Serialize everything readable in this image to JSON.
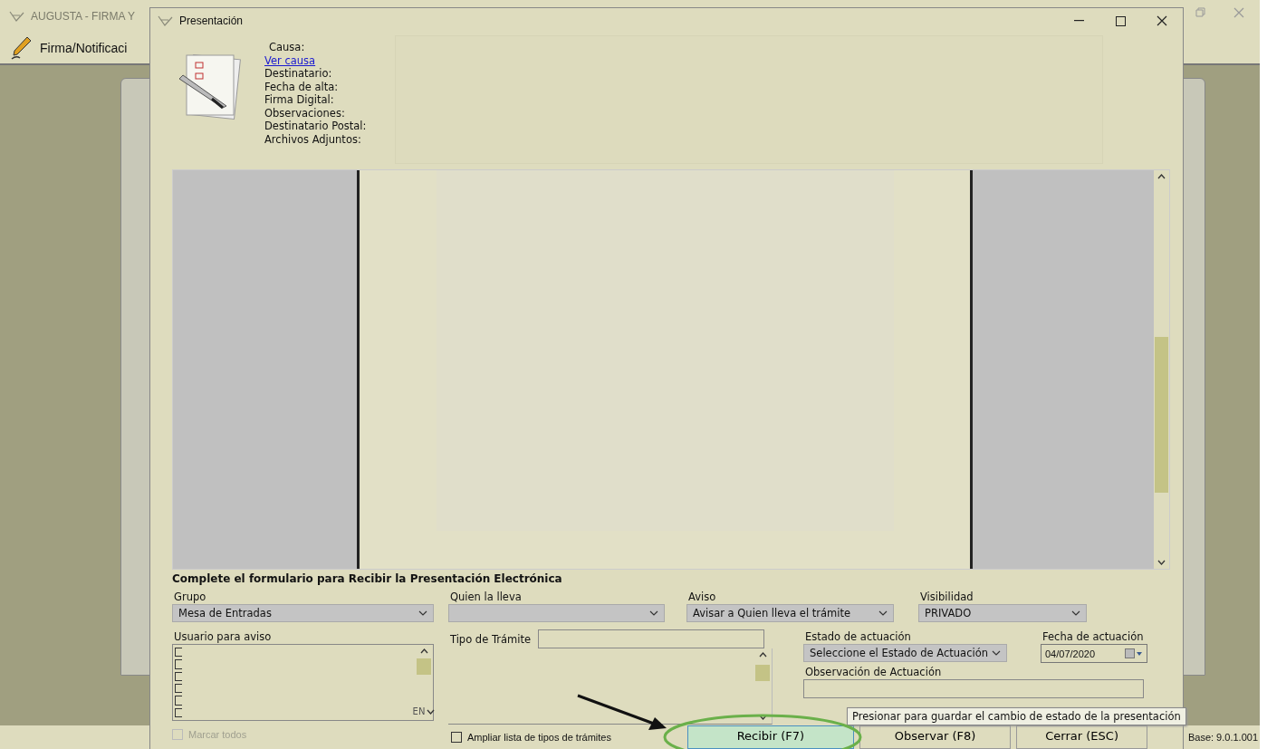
{
  "background_window": {
    "title": "AUGUSTA - FIRMA Y",
    "toolbar_item": "Firma/Notificaci",
    "status": "Base: 9.0.1.001"
  },
  "dialog": {
    "title": "Presentación",
    "details": [
      {
        "kind": "label",
        "text": "Causa:"
      },
      {
        "kind": "link",
        "text": "Ver causa"
      },
      {
        "kind": "label",
        "text": "Destinatario:"
      },
      {
        "kind": "label",
        "text": "Fecha de alta:"
      },
      {
        "kind": "label",
        "text": "Firma Digital:"
      },
      {
        "kind": "label",
        "text": "Observaciones:"
      },
      {
        "kind": "label",
        "text": "Destinatario Postal:"
      },
      {
        "kind": "label",
        "text": "Archivos Adjuntos:"
      }
    ],
    "form": {
      "heading": "Complete el formulario para Recibir la Presentación Electrónica",
      "grupo": {
        "label": "Grupo",
        "value": "Mesa de Entradas"
      },
      "quien_la_lleva": {
        "label": "Quien la lleva"
      },
      "aviso": {
        "label": "Aviso",
        "value": "Avisar a Quien lleva el trámite"
      },
      "visibilidad": {
        "label": "Visibilidad",
        "value": "PRIVADO"
      },
      "usuario_para_aviso": {
        "label": "Usuario para aviso",
        "fragment": "EN",
        "items": [
          {
            "checked": false
          },
          {
            "checked": false
          },
          {
            "checked": false
          },
          {
            "checked": false
          },
          {
            "checked": false
          },
          {
            "checked": false
          }
        ]
      },
      "marcar_todos": {
        "label": "Marcar todos",
        "checked": false,
        "disabled": true
      },
      "tipo_de_tramite": {
        "label": "Tipo de Trámite"
      },
      "ampliar": {
        "label": "Ampliar lista de tipos de trámites",
        "checked": false,
        "disabled": false
      },
      "estado": {
        "label": "Estado de actuación",
        "value": "Seleccione el Estado de Actuación"
      },
      "fecha": {
        "label": "Fecha de actuación",
        "value": "04/07/2020"
      },
      "observacion": {
        "label": "Observación de Actuación"
      }
    },
    "buttons": [
      {
        "label": "Recibir (F7)",
        "selected": true
      },
      {
        "label": "Observar (F8)",
        "selected": false
      },
      {
        "label": "Cerrar (ESC)",
        "selected": false
      }
    ],
    "tooltip": "Presionar para guardar el cambio de estado de la presentación"
  }
}
